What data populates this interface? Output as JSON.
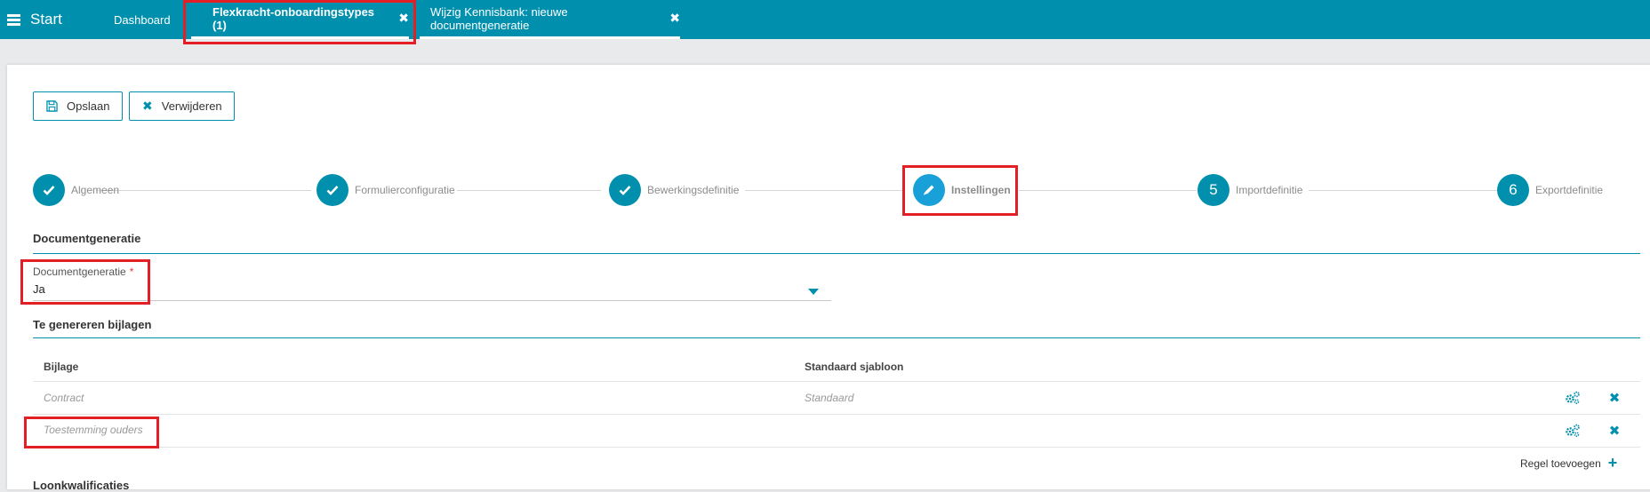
{
  "topbar": {
    "start_label": "Start",
    "tabs": [
      {
        "label": "Dashboard"
      },
      {
        "label": "Flexkracht-onboardingstypes (1)"
      },
      {
        "label": "Wijzig Kennisbank: nieuwe documentgeneratie"
      }
    ],
    "close_icon": "close-icon",
    "menu_icon": "hamburger-icon"
  },
  "toolbar": {
    "save_label": "Opslaan",
    "delete_label": "Verwijderen",
    "save_icon": "save-icon",
    "delete_icon": "close-icon"
  },
  "stepper": {
    "steps": [
      {
        "label": "Algemeen",
        "state": "done",
        "icon": "check-icon"
      },
      {
        "label": "Formulierconfiguratie",
        "state": "done",
        "icon": "check-icon"
      },
      {
        "label": "Bewerkingsdefinitie",
        "state": "done",
        "icon": "check-icon"
      },
      {
        "label": "Instellingen",
        "state": "active",
        "icon": "pencil-icon"
      },
      {
        "label": "Importdefinitie",
        "state": "todo",
        "number": "5"
      },
      {
        "label": "Exportdefinitie",
        "state": "todo",
        "number": "6"
      }
    ]
  },
  "documentgeneratie": {
    "section_title": "Documentgeneratie",
    "field_label": "Documentgeneratie",
    "required_mark": "*",
    "value": "Ja"
  },
  "bijlagen": {
    "section_title": "Te genereren bijlagen",
    "columns": [
      "Bijlage",
      "Standaard sjabloon"
    ],
    "rows": [
      {
        "bijlage": "Contract",
        "sjabloon": "Standaard"
      },
      {
        "bijlage": "Toestemming ouders",
        "sjabloon": ""
      }
    ],
    "add_row_label": "Regel toevoegen",
    "row_settings_icon": "gears-icon",
    "row_delete_icon": "close-icon"
  },
  "next_section_partial": "Loonkwalificaties",
  "colors": {
    "accent": "#0090ae",
    "active_step": "#1aa0d8",
    "highlight": "#e31e24",
    "required": "#e53935"
  }
}
